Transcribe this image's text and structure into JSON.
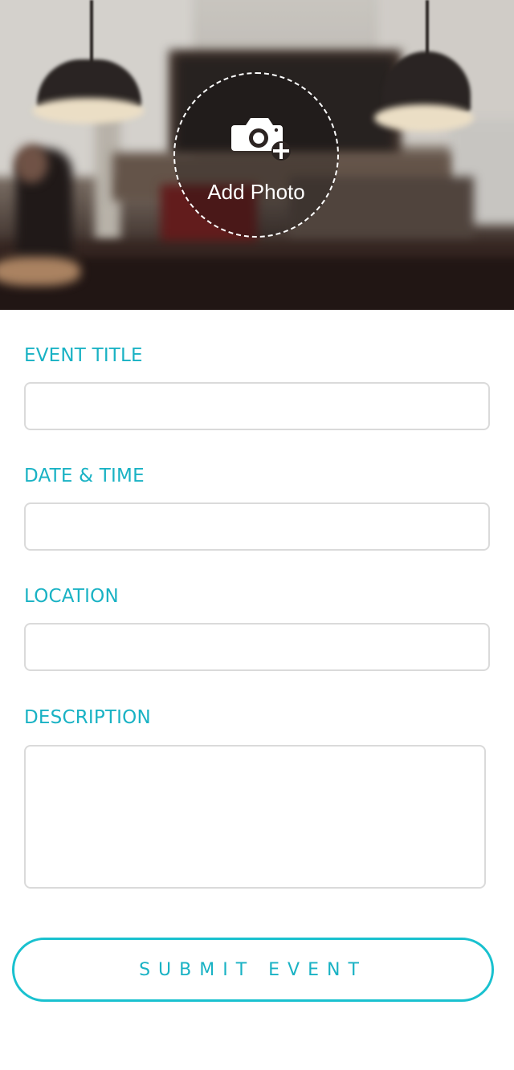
{
  "header": {
    "add_photo_label": "Add Photo",
    "photo_icon": "camera-add-icon"
  },
  "form": {
    "event_title": {
      "label": "EVENT TITLE",
      "value": ""
    },
    "date_time": {
      "label": "DATE & TIME",
      "value": ""
    },
    "location": {
      "label": "LOCATION",
      "value": ""
    },
    "description": {
      "label": "DESCRIPTION",
      "value": ""
    }
  },
  "actions": {
    "submit_label": "SUBMIT EVENT"
  },
  "colors": {
    "accent": "#19b2c4",
    "field_border": "#dadada"
  }
}
